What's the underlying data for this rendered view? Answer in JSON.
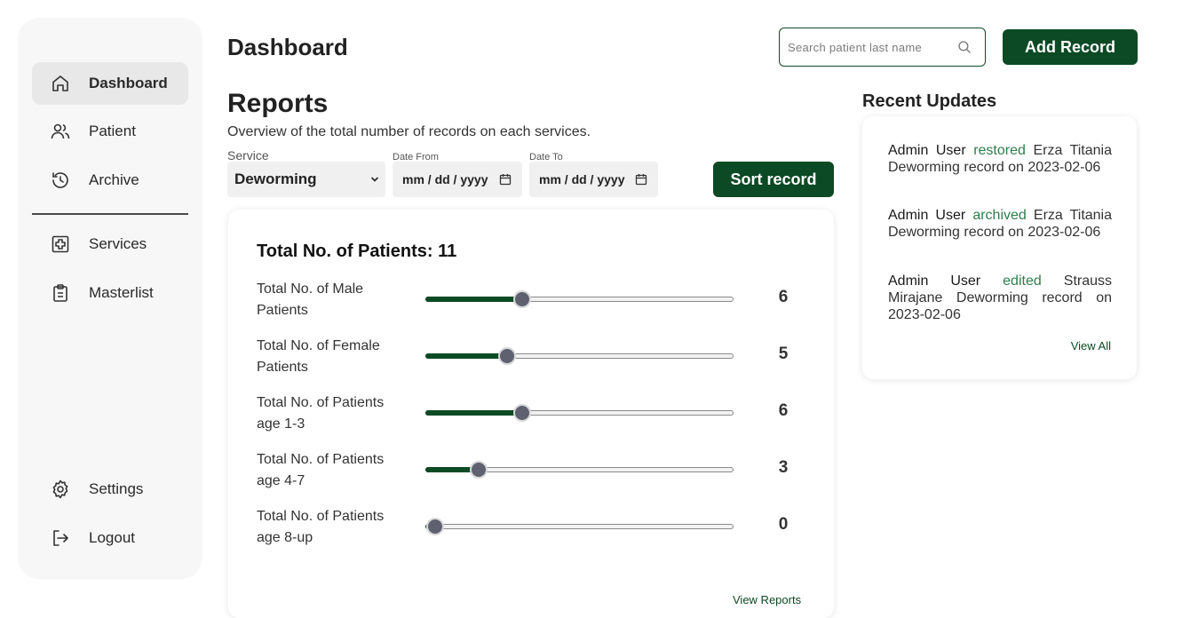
{
  "header": {
    "page_title": "Dashboard",
    "search_placeholder": "Search patient last name",
    "add_record_label": "Add Record"
  },
  "sidebar": {
    "items": [
      {
        "label": "Dashboard",
        "icon": "home-icon",
        "active": true
      },
      {
        "label": "Patient",
        "icon": "users-icon"
      },
      {
        "label": "Archive",
        "icon": "history-icon"
      },
      {
        "label": "Services",
        "icon": "medical-plus-icon"
      },
      {
        "label": "Masterlist",
        "icon": "clipboard-icon"
      },
      {
        "label": "Settings",
        "icon": "gear-icon"
      },
      {
        "label": "Logout",
        "icon": "logout-icon"
      }
    ]
  },
  "reports": {
    "title": "Reports",
    "subtitle": "Overview of the total number of records on each services.",
    "service_label": "Service",
    "service_value": "Deworming",
    "date_from_label": "Date From",
    "date_from_value": "mm / dd / yyyy",
    "date_to_label": "Date To",
    "date_to_value": "mm / dd / yyyy",
    "sort_label": "Sort record",
    "total_title": "Total No. of Patients: 11",
    "stats": [
      {
        "label": "Total No. of Male Patients",
        "value": "6",
        "fraction": 0.3125
      },
      {
        "label": "Total No. of Female Patients",
        "value": "5",
        "fraction": 0.2645
      },
      {
        "label": "Total No. of Patients age 1-3",
        "value": "6",
        "fraction": 0.3125
      },
      {
        "label": "Total No. of Patients age 4-7",
        "value": "3",
        "fraction": 0.1715
      },
      {
        "label": "Total No. of Patients age 8-up",
        "value": "0",
        "fraction": 0.029
      }
    ],
    "view_reports_label": "View Reports"
  },
  "recent_updates": {
    "title": "Recent Updates",
    "items": [
      {
        "actor": "Admin User",
        "action": "restored",
        "rest": "Erza Titania Deworming record on 2023-02-06"
      },
      {
        "actor": "Admin User",
        "action": "archived",
        "rest": "Erza Titania Deworming record on 2023-02-06"
      },
      {
        "actor": "Admin User",
        "action": "edited",
        "rest": "Strauss Mirajane Deworming record on 2023-02-06"
      }
    ],
    "view_all_label": "View All"
  },
  "colors": {
    "brand_green": "#0b4a24",
    "action_green": "#2e7d4a",
    "slider_thumb": "#5f6170"
  }
}
